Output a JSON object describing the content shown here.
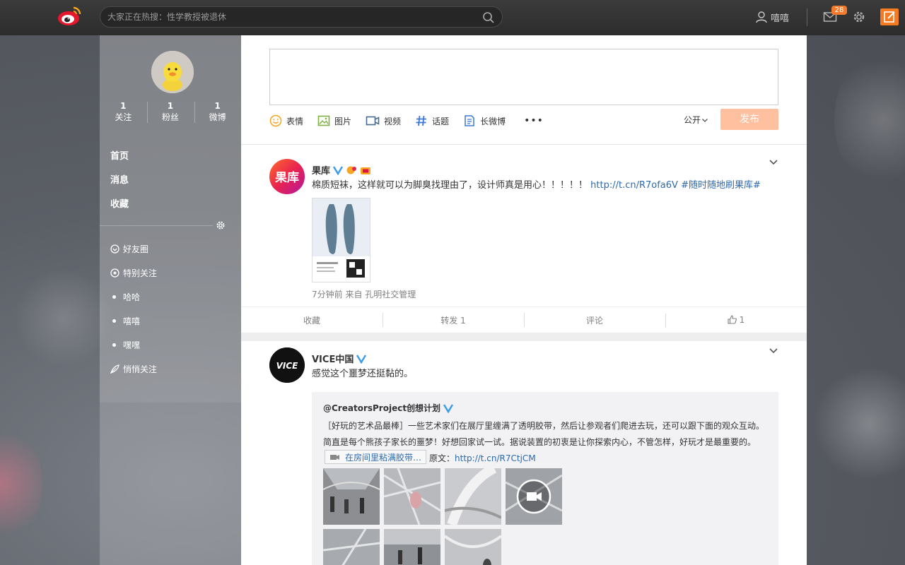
{
  "topbar": {
    "search_placeholder": "大家正在热搜：性学教授被退休",
    "username": "嘻嘻",
    "mail_badge": "28"
  },
  "sidebar": {
    "stats": [
      {
        "count": "1",
        "label": "关注"
      },
      {
        "count": "1",
        "label": "粉丝"
      },
      {
        "count": "1",
        "label": "微博"
      }
    ],
    "nav": [
      "首页",
      "消息",
      "收藏"
    ],
    "groups": [
      {
        "label": "好友圈",
        "icon": "friends-circle-icon"
      },
      {
        "label": "特别关注",
        "icon": "special-follow-icon"
      },
      {
        "label": "哈哈",
        "icon": "dot-icon"
      },
      {
        "label": "嘻嘻",
        "icon": "dot-icon"
      },
      {
        "label": "嘿嘿",
        "icon": "dot-icon"
      },
      {
        "label": "悄悄关注",
        "icon": "quiet-follow-icon"
      }
    ]
  },
  "composer": {
    "tools": [
      {
        "label": "表情",
        "icon": "emoji-icon"
      },
      {
        "label": "图片",
        "icon": "image-icon"
      },
      {
        "label": "视频",
        "icon": "video-icon"
      },
      {
        "label": "话题",
        "icon": "hashtag-icon"
      },
      {
        "label": "长微博",
        "icon": "long-post-icon"
      }
    ],
    "more": "•••",
    "visibility": "公开",
    "publish": "发布"
  },
  "posts": [
    {
      "author": "果库",
      "avatar_text": "果库",
      "text": "棉质短袜，这样就可以为脚臭找理由了，设计师真是用心！！！！！",
      "link": "http://t.cn/R7ofa6V",
      "hashtag": "#随时随地刷果库#",
      "meta": "7分钟前 来自 孔明社交管理",
      "actions": {
        "favorite": "收藏",
        "repost": "转发 1",
        "comment": "评论",
        "like": "1"
      }
    },
    {
      "author": "VICE中国",
      "avatar_text": "VICE",
      "text": "感觉这个噩梦还挺黏的。",
      "repost": {
        "author": "@CreatorsProject创想计划",
        "line1": "［好玩的艺术品最棒］一些艺术家们在展厅里缠满了透明胶带，然后让参观者们爬进去玩，还可以跟下面的观众互动。",
        "line2": "简直是每个熊孩子家长的噩梦！好想回家试一试。据说装置的初衷是让你探索内心，不管怎样，好玩才是最重要的。",
        "video_tag": "在房间里粘满胶带…",
        "orig_label": "原文：",
        "orig_link": "http://t.cn/R7CtjCM"
      }
    }
  ],
  "colors": {
    "accent": "#f57b23",
    "link": "#2d6aae",
    "publish_disabled": "#ffc09f"
  }
}
